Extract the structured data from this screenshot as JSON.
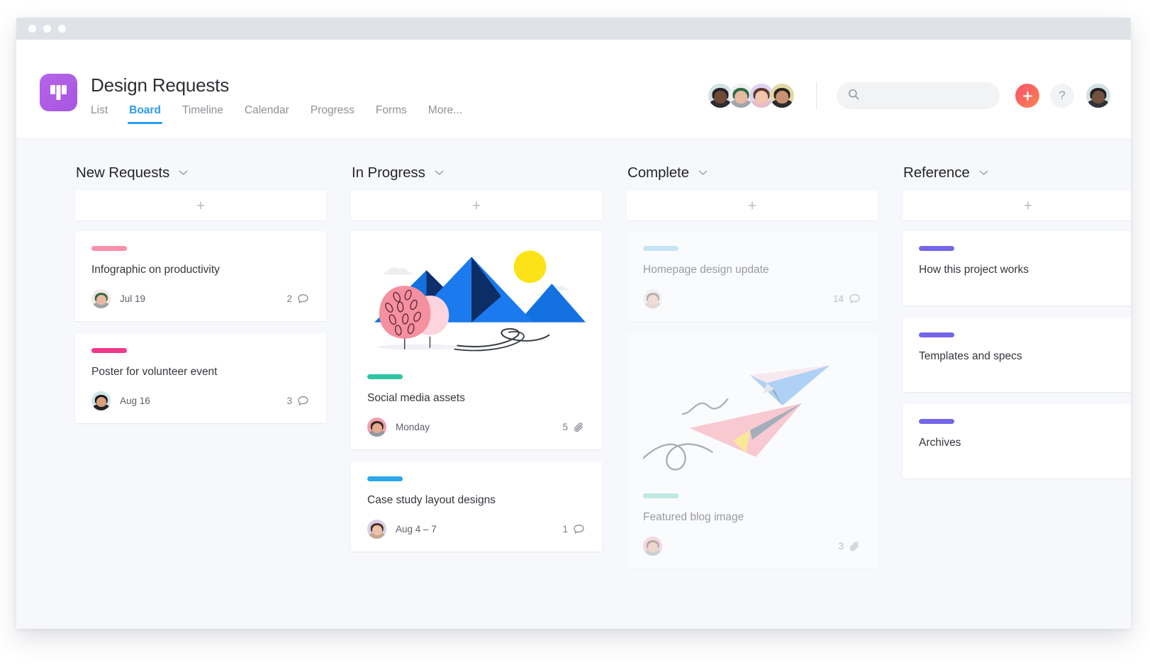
{
  "window": {
    "traffic_lights": [
      "close",
      "minimize",
      "maximize"
    ]
  },
  "header": {
    "logo_icon": "board-columns-icon",
    "logo_color": "#a855e0",
    "project_title": "Design Requests",
    "tabs": [
      {
        "label": "List",
        "active": false
      },
      {
        "label": "Board",
        "active": true
      },
      {
        "label": "Timeline",
        "active": false
      },
      {
        "label": "Calendar",
        "active": false
      },
      {
        "label": "Progress",
        "active": false
      },
      {
        "label": "Forms",
        "active": false
      },
      {
        "label": "More...",
        "active": false
      }
    ],
    "active_tab_color": "#2a9dee",
    "members": [
      {
        "name": "member-1",
        "bg": "#cfe3e4",
        "hair": "#262128",
        "skin": "#6f4a36",
        "body": "#2d2b33"
      },
      {
        "name": "member-2",
        "bg": "#f0f0f0",
        "hair": "#2c6b46",
        "skin": "#e9b9a1",
        "body": "#9fa6ab"
      },
      {
        "name": "member-3",
        "bg": "#ddd3f0",
        "hair": "#5b3b2e",
        "skin": "#f2c5ae",
        "body": "#e9bccd"
      },
      {
        "name": "member-4",
        "bg": "#e0d9a6",
        "hair": "#2a2320",
        "skin": "#c89272",
        "body": "#2e2b2d"
      }
    ],
    "search": {
      "value": "",
      "placeholder": "",
      "icon": "search-icon"
    },
    "add_button": {
      "icon": "plus-icon",
      "label": "+",
      "color": "#fb6a5c"
    },
    "help_button": {
      "icon": "question-mark-icon",
      "label": "?"
    },
    "current_user_avatar": {
      "name": "current-user",
      "bg": "#cfe3e4",
      "hair": "#241f24",
      "skin": "#71523d",
      "body": "#30333a"
    }
  },
  "board": {
    "add_card_icon": "plus-icon",
    "chevron_icon": "chevron-down-icon",
    "columns": [
      {
        "title": "New Requests",
        "cards": [
          {
            "title": "Infographic on productivity",
            "tag_color": "#fb8fa8",
            "date": "Jul 19",
            "count": "2",
            "count_icon": "comment-icon",
            "cover": null,
            "dim": false,
            "avatar": {
              "bg": "#f3e9e4",
              "hair": "#2c6b46",
              "skin": "#e9b9a1",
              "body": "#9fa6ab"
            }
          },
          {
            "title": "Poster for volunteer event",
            "tag_color": "#f0398b",
            "date": "Aug 16",
            "count": "3",
            "count_icon": "comment-icon",
            "cover": null,
            "dim": false,
            "avatar": {
              "bg": "#cfe6e8",
              "hair": "#1d1a1c",
              "skin": "#d9a07c",
              "body": "#262227"
            }
          }
        ]
      },
      {
        "title": "In Progress",
        "cards": [
          {
            "title": "Social media assets",
            "tag_color": "#2fc4a5",
            "date": "Monday",
            "count": "5",
            "count_icon": "attachment-icon",
            "cover": "mountains-illustration",
            "dim": false,
            "avatar": {
              "bg": "#f2a0ae",
              "hair": "#3a2a20",
              "skin": "#e4ab8c",
              "body": "#8f9aa6"
            }
          },
          {
            "title": "Case study layout designs",
            "tag_color": "#2aa8e8",
            "date": "Aug 4 – 7",
            "count": "1",
            "count_icon": "comment-icon",
            "cover": null,
            "dim": false,
            "avatar": {
              "bg": "#d9cfe8",
              "hair": "#4a3327",
              "skin": "#eec3ac",
              "body": "#c6a78e"
            }
          }
        ]
      },
      {
        "title": "Complete",
        "cards": [
          {
            "title": "Homepage design update",
            "tag_color": "#8fd2f0",
            "date": "",
            "count": "14",
            "count_icon": "comment-icon",
            "cover": null,
            "dim": true,
            "avatar": {
              "bg": "#eae6f0",
              "hair": "#7a6453",
              "skin": "#e9c3ae",
              "body": "#cbb8a6"
            }
          },
          {
            "title": "Featured blog image",
            "tag_color": "#7fd9c4",
            "date": "",
            "count": "3",
            "count_icon": "attachment-icon",
            "cover": "paper-planes-illustration",
            "dim": true,
            "avatar": {
              "bg": "#f2b9c2",
              "hair": "#6b5a4a",
              "skin": "#e3b79c",
              "body": "#9aa3ab"
            }
          }
        ]
      },
      {
        "title": "Reference",
        "cards": [
          {
            "title": "How this project works",
            "tag_color": "#7466e8",
            "date": "",
            "count": "",
            "count_icon": null,
            "cover": null,
            "dim": false,
            "avatar": null
          },
          {
            "title": "Templates and specs",
            "tag_color": "#7466e8",
            "date": "",
            "count": "",
            "count_icon": null,
            "cover": null,
            "dim": false,
            "avatar": null
          },
          {
            "title": "Archives",
            "tag_color": "#7466e8",
            "date": "",
            "count": "",
            "count_icon": null,
            "cover": null,
            "dim": false,
            "avatar": null
          }
        ]
      }
    ]
  }
}
